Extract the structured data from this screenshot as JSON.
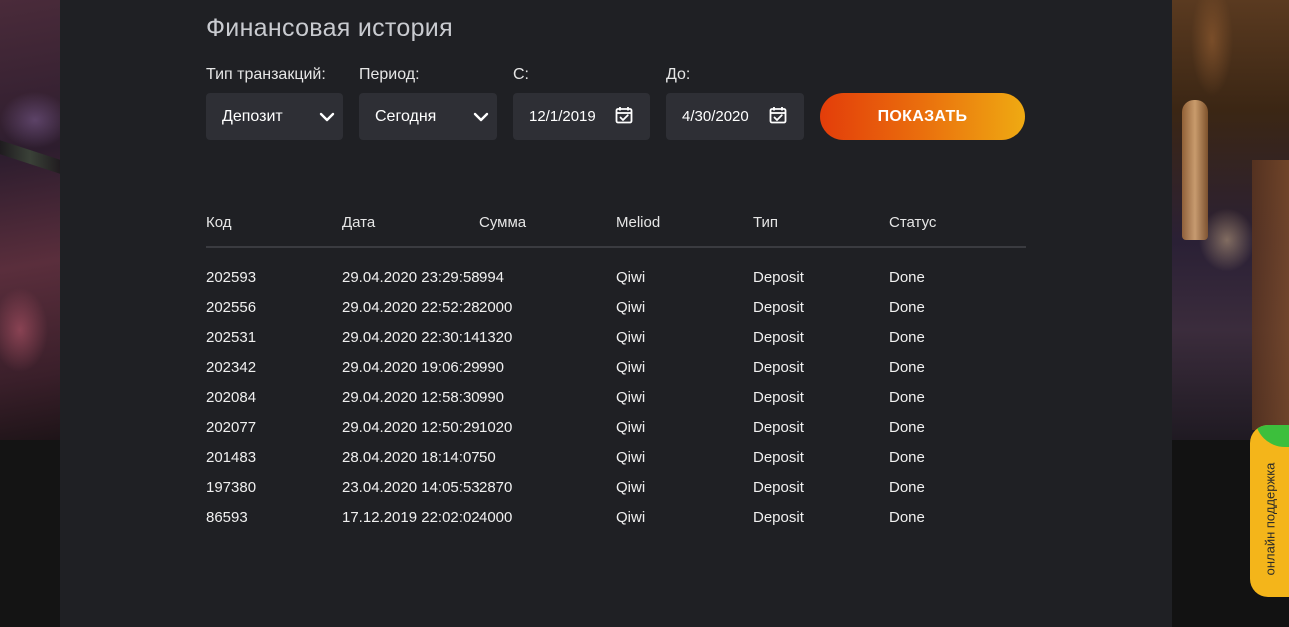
{
  "page": {
    "title": "Финансовая история"
  },
  "filters": {
    "type": {
      "label": "Тип транзакций:",
      "value": "Депозит"
    },
    "period": {
      "label": "Период:",
      "value": "Сегодня"
    },
    "from": {
      "label": "С:",
      "value": "12/1/2019"
    },
    "to": {
      "label": "До:",
      "value": "4/30/2020"
    },
    "show_button": "ПОКАЗАТЬ"
  },
  "table": {
    "headers": [
      "Код",
      "Дата",
      "Сумма",
      "Meliod",
      "Тип",
      "Статус"
    ],
    "rows": [
      [
        "202593",
        "29.04.2020 23:29:58",
        "994",
        "Qiwi",
        "Deposit",
        "Done"
      ],
      [
        "202556",
        "29.04.2020 22:52:28",
        "2000",
        "Qiwi",
        "Deposit",
        "Done"
      ],
      [
        "202531",
        "29.04.2020 22:30:14",
        "1320",
        "Qiwi",
        "Deposit",
        "Done"
      ],
      [
        "202342",
        "29.04.2020 19:06:29",
        "990",
        "Qiwi",
        "Deposit",
        "Done"
      ],
      [
        "202084",
        "29.04.2020 12:58:30",
        "990",
        "Qiwi",
        "Deposit",
        "Done"
      ],
      [
        "202077",
        "29.04.2020 12:50:29",
        "1020",
        "Qiwi",
        "Deposit",
        "Done"
      ],
      [
        "201483",
        "28.04.2020 18:14:07",
        "50",
        "Qiwi",
        "Deposit",
        "Done"
      ],
      [
        "197380",
        "23.04.2020 14:05:53",
        "2870",
        "Qiwi",
        "Deposit",
        "Done"
      ],
      [
        "86593",
        "17.12.2019 22:02:02",
        "4000",
        "Qiwi",
        "Deposit",
        "Done"
      ]
    ]
  },
  "support": {
    "label": "онлайн поддержка",
    "online_color": "#3cbf3c",
    "tab_color": "#f4b51a"
  },
  "icons": {
    "select_arrow": "chevron-down-icon",
    "date_picker": "calendar-check-icon"
  },
  "colors": {
    "panel": "#1f2024",
    "control": "#2e2f35",
    "button_gradient_start": "#e33d0a",
    "button_gradient_end": "#efaa12"
  }
}
